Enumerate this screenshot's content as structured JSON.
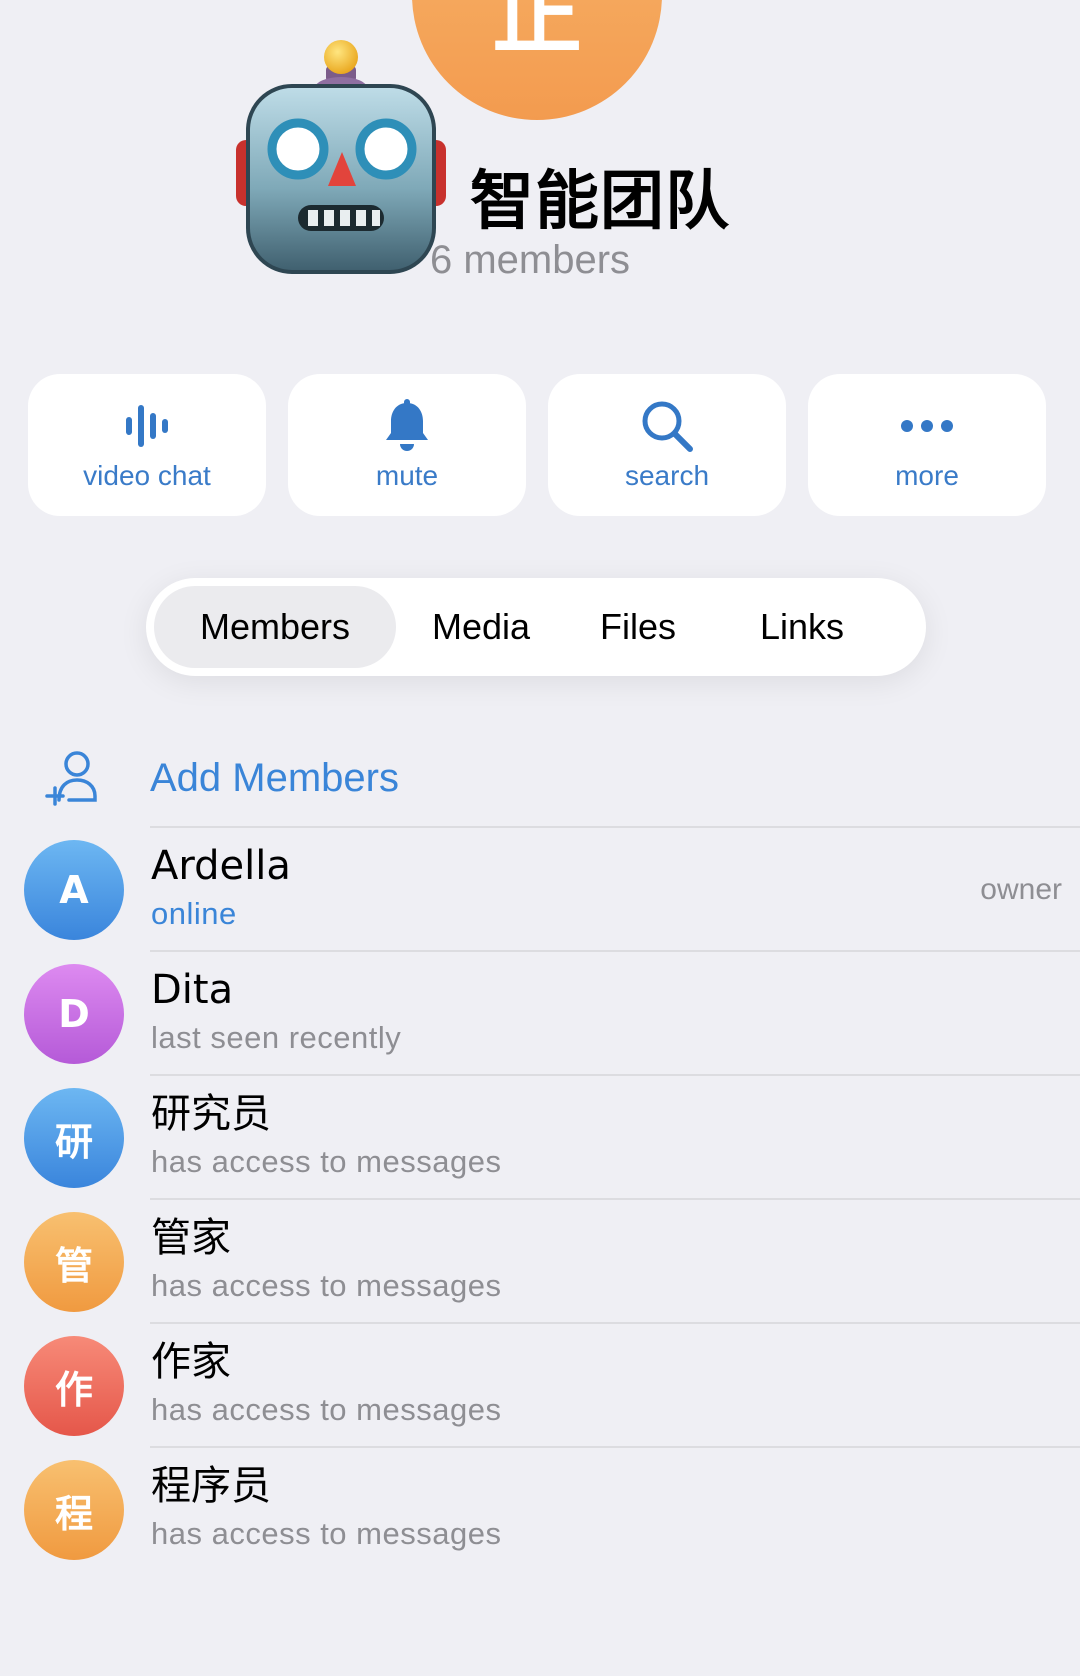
{
  "group": {
    "top_avatar_letter": "正",
    "title": "智能团队",
    "subtitle": "6 members"
  },
  "actions": [
    {
      "label": "video chat",
      "icon": "voice-chat-icon"
    },
    {
      "label": "mute",
      "icon": "bell-icon"
    },
    {
      "label": "search",
      "icon": "search-icon"
    },
    {
      "label": "more",
      "icon": "more-dots-icon"
    }
  ],
  "tabs": [
    {
      "label": "Members",
      "active": true
    },
    {
      "label": "Media",
      "active": false
    },
    {
      "label": "Files",
      "active": false
    },
    {
      "label": "Links",
      "active": false
    }
  ],
  "add_members": {
    "label": "Add Members",
    "icon": "add-person-icon"
  },
  "members": [
    {
      "initial": "A",
      "name": "Ardella",
      "status": "online",
      "role": "owner",
      "color": "#4a9be6"
    },
    {
      "initial": "D",
      "name": "Dita",
      "status": "last seen recently",
      "role": "",
      "color": "#c466e3"
    },
    {
      "initial": "研",
      "name": "研究员",
      "status": "has access to messages",
      "role": "",
      "color": "#4a9be6"
    },
    {
      "initial": "管",
      "name": "管家",
      "status": "has access to messages",
      "role": "",
      "color": "#f3a84f"
    },
    {
      "initial": "作",
      "name": "作家",
      "status": "has access to messages",
      "role": "",
      "color": "#ee6a5b"
    },
    {
      "initial": "程",
      "name": "程序员",
      "status": "has access to messages",
      "role": "",
      "color": "#f3a84f"
    }
  ],
  "colors": {
    "accent": "#3a85d8",
    "background": "#efeff4"
  }
}
